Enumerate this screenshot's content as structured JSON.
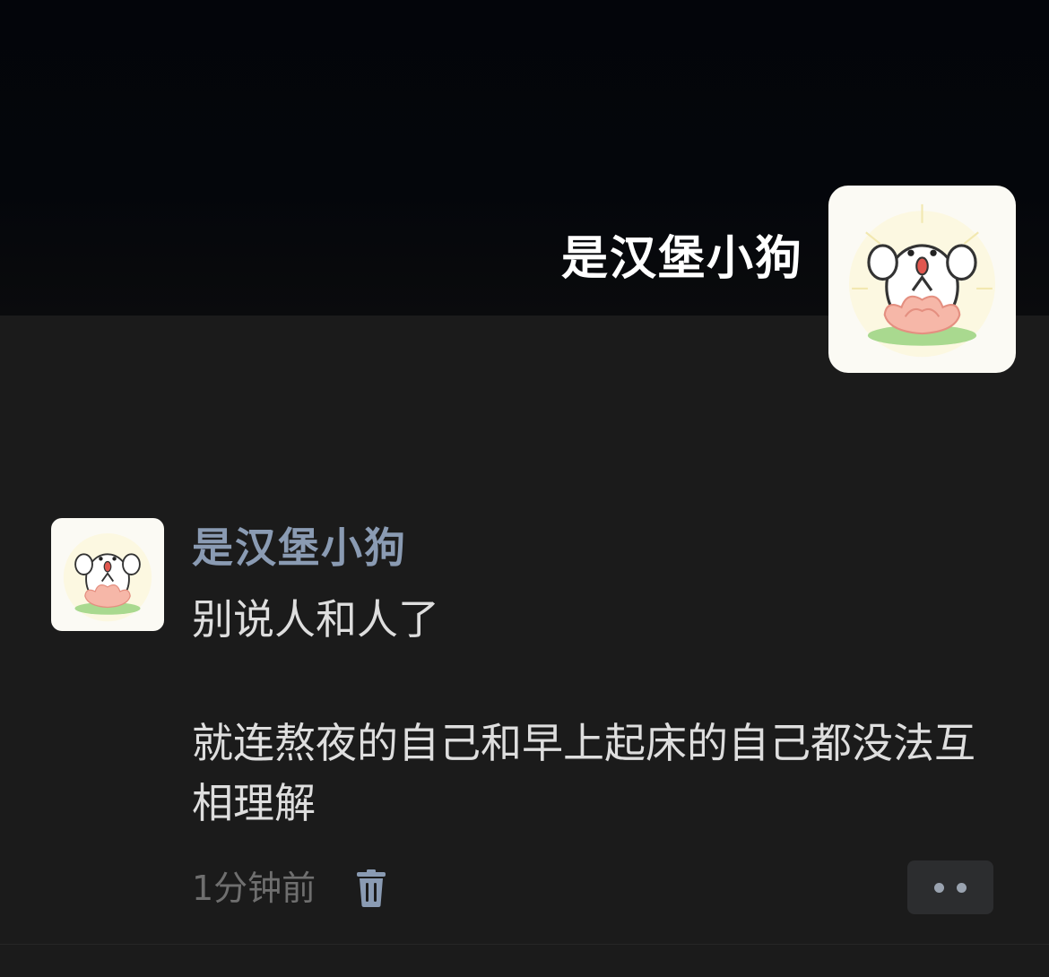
{
  "profile": {
    "name": "是汉堡小狗",
    "avatar_icon": "meditating-puppy-avatar"
  },
  "comment": {
    "username": "是汉堡小狗",
    "avatar_icon": "meditating-puppy-avatar",
    "lines": [
      "别说人和人了",
      "就连熬夜的自己和早上起床的自己都没法互相理解"
    ],
    "timestamp": "1分钟前",
    "delete_icon": "trash-icon",
    "more_icon": "more-dots-icon"
  },
  "colors": {
    "username": "#8a9bb3",
    "body_text": "#dedede",
    "background": "#1b1b1b"
  }
}
